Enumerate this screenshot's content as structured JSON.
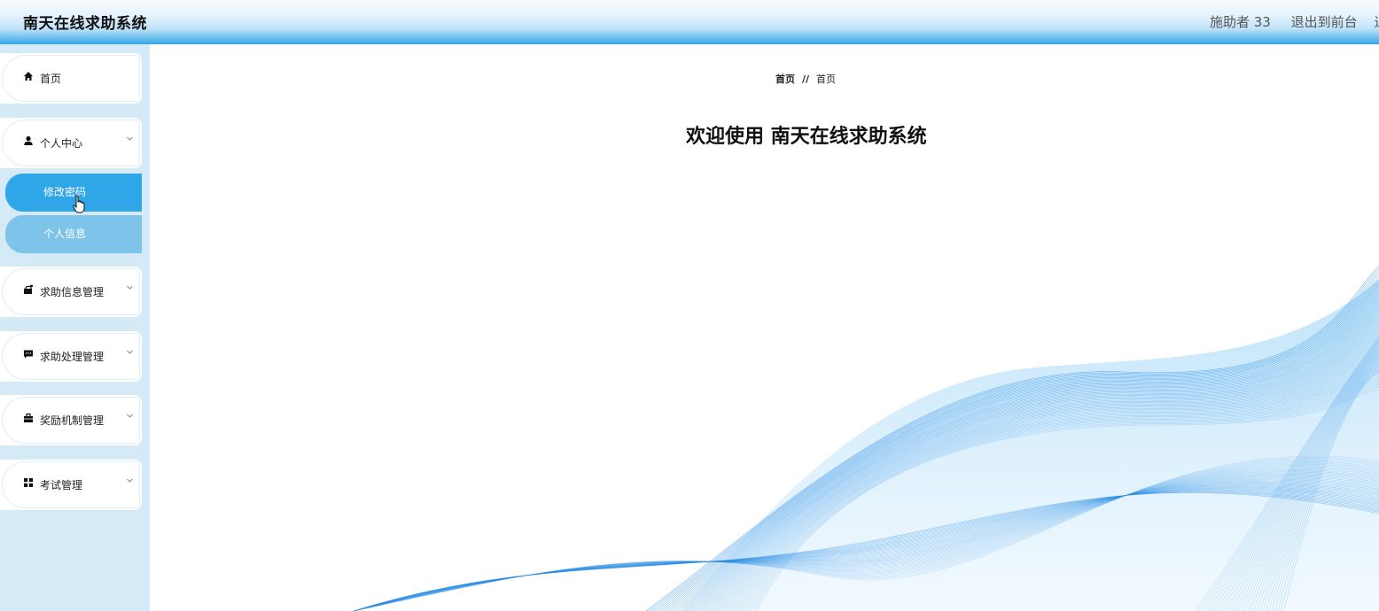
{
  "header": {
    "app_title": "南天在线求助系统",
    "user_label": "施助者 33",
    "front_link": "退出到前台",
    "extra_link": "退"
  },
  "sidebar": {
    "items": [
      {
        "label": "首页",
        "icon": "home-icon"
      },
      {
        "label": "个人中心",
        "icon": "user-icon",
        "expanded": true,
        "children": [
          {
            "label": "修改密码",
            "active": true
          },
          {
            "label": "个人信息",
            "active": false
          }
        ]
      },
      {
        "label": "求助信息管理",
        "icon": "mailbox-icon"
      },
      {
        "label": "求助处理管理",
        "icon": "comment-icon"
      },
      {
        "label": "奖励机制管理",
        "icon": "briefcase-icon"
      },
      {
        "label": "考试管理",
        "icon": "grid-icon"
      }
    ]
  },
  "main": {
    "breadcrumb": {
      "first": "首页",
      "separator": "//",
      "current": "首页"
    },
    "welcome": "欢迎使用 南天在线求助系统"
  },
  "colors": {
    "accent": "#2fa6e8",
    "sidebar_bg": "#d4eaf7",
    "submenu_inactive": "#7ec4ea",
    "wave": "#2b8fe6"
  }
}
